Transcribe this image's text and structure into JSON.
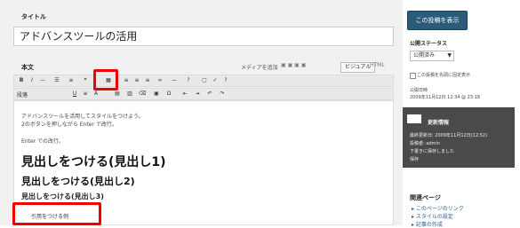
{
  "editor": {
    "title_label": "タイトル",
    "title_value": "アドバンスツールの活用",
    "body_label": "本文",
    "mode_text": "メディアを追加",
    "mode_visual": "ビジュアル",
    "mode_html": "HTML",
    "format_select": "段落",
    "paragraph1": "アドバンスツールを活用してスタイルをつけよう。",
    "paragraph2": "2のボタンを押しながら Enter で改行。",
    "paragraph3": "Enter での改行。",
    "heading1": "見出しをつける(見出し1)",
    "heading2": "見出しをつける(見出し2)",
    "heading3": "見出しをつける(見出し3)",
    "small_note": "引用をつける例"
  },
  "sidebar": {
    "preview_button": "この投稿を表示",
    "status_label": "公開ステータス",
    "status_select": "公開済み",
    "sticky_label": "この投稿を先頭に固定表示",
    "date_label": "公開日時",
    "date_value": "2009年11月12日 12:34 @ 23:18",
    "dark_title": "更新情報",
    "dark_line1": "最終更新日: 2009年11月12日(12:52)",
    "dark_line2": "投稿者: admin",
    "dark_line3": "下書きに保存しました",
    "dark_line4": "保存",
    "related_label": "関連ページ",
    "related_items": [
      "このページのリンク",
      "スタイルの設定",
      "記事の作成"
    ]
  }
}
